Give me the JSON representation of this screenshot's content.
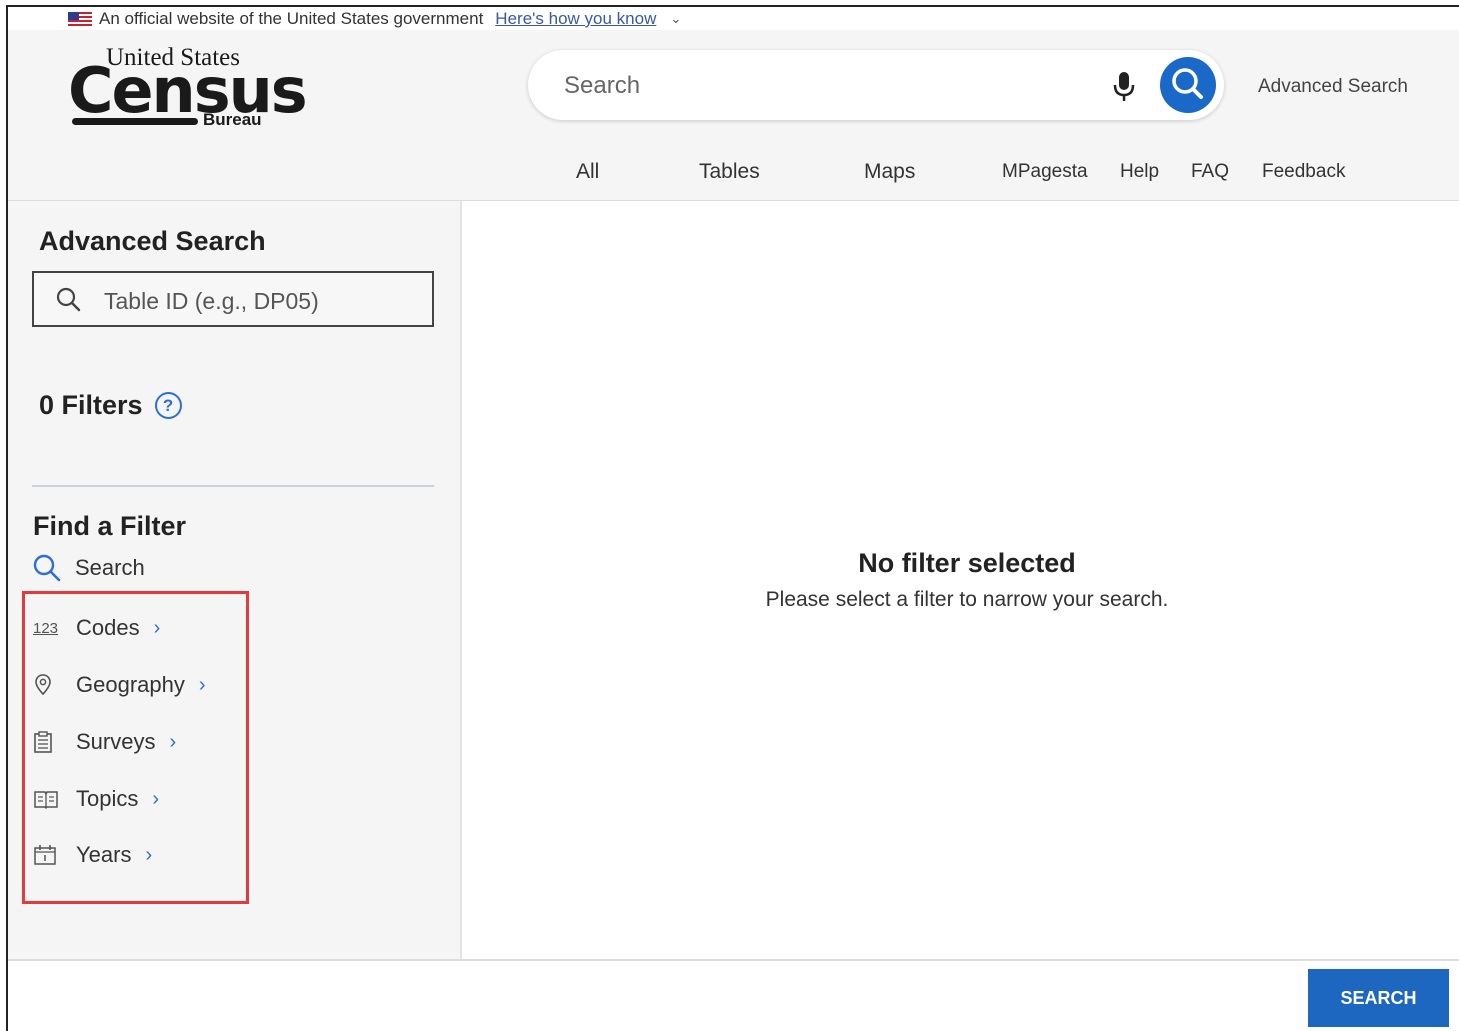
{
  "banner": {
    "text": "An official website of the United States government",
    "link": "Here's how you know"
  },
  "logo": {
    "top": "United States",
    "main": "Census",
    "bottom": "Bureau"
  },
  "search": {
    "placeholder": "Search"
  },
  "header": {
    "advanced_search": "Advanced Search"
  },
  "nav": {
    "all": "All",
    "tables": "Tables",
    "maps": "Maps",
    "pages": "MPagesta",
    "help": "Help",
    "faq": "FAQ",
    "feedback": "Feedback"
  },
  "sidebar": {
    "title": "Advanced Search",
    "table_id_placeholder": "Table ID (e.g., DP05)",
    "filters_count": "0 Filters",
    "find_title": "Find a Filter",
    "search_label": "Search",
    "items": [
      {
        "label": "Codes",
        "icon": "123-icon"
      },
      {
        "label": "Geography",
        "icon": "location-pin-icon"
      },
      {
        "label": "Surveys",
        "icon": "clipboard-icon"
      },
      {
        "label": "Topics",
        "icon": "book-icon"
      },
      {
        "label": "Years",
        "icon": "calendar-icon"
      }
    ]
  },
  "main": {
    "empty_title": "No filter selected",
    "empty_subtitle": "Please select a filter to narrow your search."
  },
  "footer": {
    "search_button": "SEARCH"
  },
  "colors": {
    "accent": "#1a68c8",
    "highlight": "#e33a3e"
  }
}
